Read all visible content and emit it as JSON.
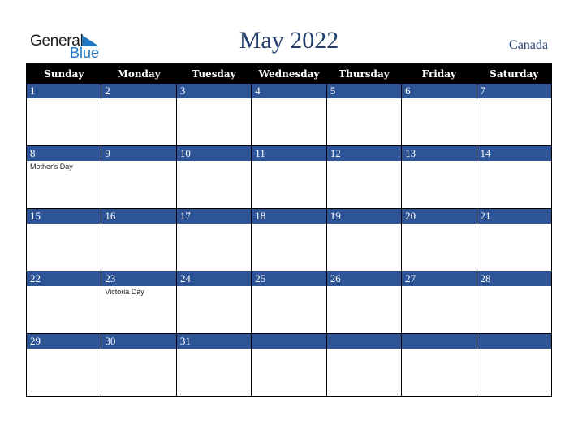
{
  "header": {
    "logo_word1": "General",
    "logo_word2": "Blue",
    "title": "May 2022",
    "country": "Canada"
  },
  "colors": {
    "accent": "#2c5496",
    "title": "#233f6e",
    "logo_blue": "#1f78c1"
  },
  "weekdays": [
    "Sunday",
    "Monday",
    "Tuesday",
    "Wednesday",
    "Thursday",
    "Friday",
    "Saturday"
  ],
  "weeks": [
    [
      {
        "day": "1",
        "event": ""
      },
      {
        "day": "2",
        "event": ""
      },
      {
        "day": "3",
        "event": ""
      },
      {
        "day": "4",
        "event": ""
      },
      {
        "day": "5",
        "event": ""
      },
      {
        "day": "6",
        "event": ""
      },
      {
        "day": "7",
        "event": ""
      }
    ],
    [
      {
        "day": "8",
        "event": "Mother's Day"
      },
      {
        "day": "9",
        "event": ""
      },
      {
        "day": "10",
        "event": ""
      },
      {
        "day": "11",
        "event": ""
      },
      {
        "day": "12",
        "event": ""
      },
      {
        "day": "13",
        "event": ""
      },
      {
        "day": "14",
        "event": ""
      }
    ],
    [
      {
        "day": "15",
        "event": ""
      },
      {
        "day": "16",
        "event": ""
      },
      {
        "day": "17",
        "event": ""
      },
      {
        "day": "18",
        "event": ""
      },
      {
        "day": "19",
        "event": ""
      },
      {
        "day": "20",
        "event": ""
      },
      {
        "day": "21",
        "event": ""
      }
    ],
    [
      {
        "day": "22",
        "event": ""
      },
      {
        "day": "23",
        "event": "Victoria Day"
      },
      {
        "day": "24",
        "event": ""
      },
      {
        "day": "25",
        "event": ""
      },
      {
        "day": "26",
        "event": ""
      },
      {
        "day": "27",
        "event": ""
      },
      {
        "day": "28",
        "event": ""
      }
    ],
    [
      {
        "day": "29",
        "event": ""
      },
      {
        "day": "30",
        "event": ""
      },
      {
        "day": "31",
        "event": ""
      },
      {
        "day": "",
        "event": ""
      },
      {
        "day": "",
        "event": ""
      },
      {
        "day": "",
        "event": ""
      },
      {
        "day": "",
        "event": ""
      }
    ]
  ]
}
